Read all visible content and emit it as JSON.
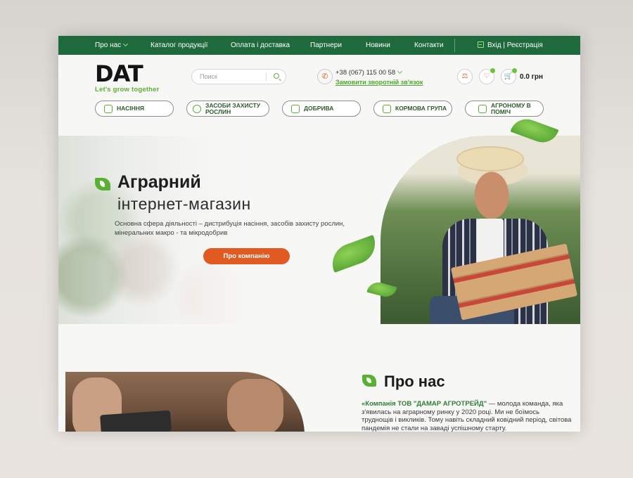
{
  "topnav": {
    "items": [
      "Про нас",
      "Каталог продукції",
      "Оплата і доставка",
      "Партнери",
      "Новини",
      "Контакти"
    ],
    "login": "Вхід | Реєстрація"
  },
  "header": {
    "logo_text": "DAT",
    "logo_tagline": "Let's grow together",
    "search_placeholder": "Поиск",
    "phone": "+38 (067) 115 00 58",
    "callback": "Замовити зворотній зв'язок",
    "cart_total": "0.0 грн",
    "icons": [
      "compare-icon",
      "wishlist-icon",
      "cart-icon"
    ]
  },
  "categories": [
    "НАСІННЯ",
    "ЗАСОБИ ЗАХИСТУ РОСЛИН",
    "ДОБРИВА",
    "КОРМОВА ГРУПА",
    "АГРОНОМУ В ПОМІЧ"
  ],
  "hero": {
    "title_line1": "Аграрний",
    "title_line2": "інтернет-магазин",
    "text": "Основна сфера діяльності – дистрибуція насіння, засобів захисту рослин, мінеральних макро - та мікродобрив",
    "button": "Про компанію"
  },
  "about": {
    "title": "Про нас",
    "company": "«Компанія ТОВ \"ДАМАР АГРОТРЕЙД\"",
    "text": " — молода команда, яка з'явилась на аграрному ринку у 2020 році. Ми не боїмось труднощів і викликів. Тому навіть складний ковідний період, світова пандемія не стали на заваді успішному старту."
  },
  "colors": {
    "brand_green": "#1f6a3c",
    "accent_green": "#5bb033",
    "accent_orange": "#e15a22"
  }
}
